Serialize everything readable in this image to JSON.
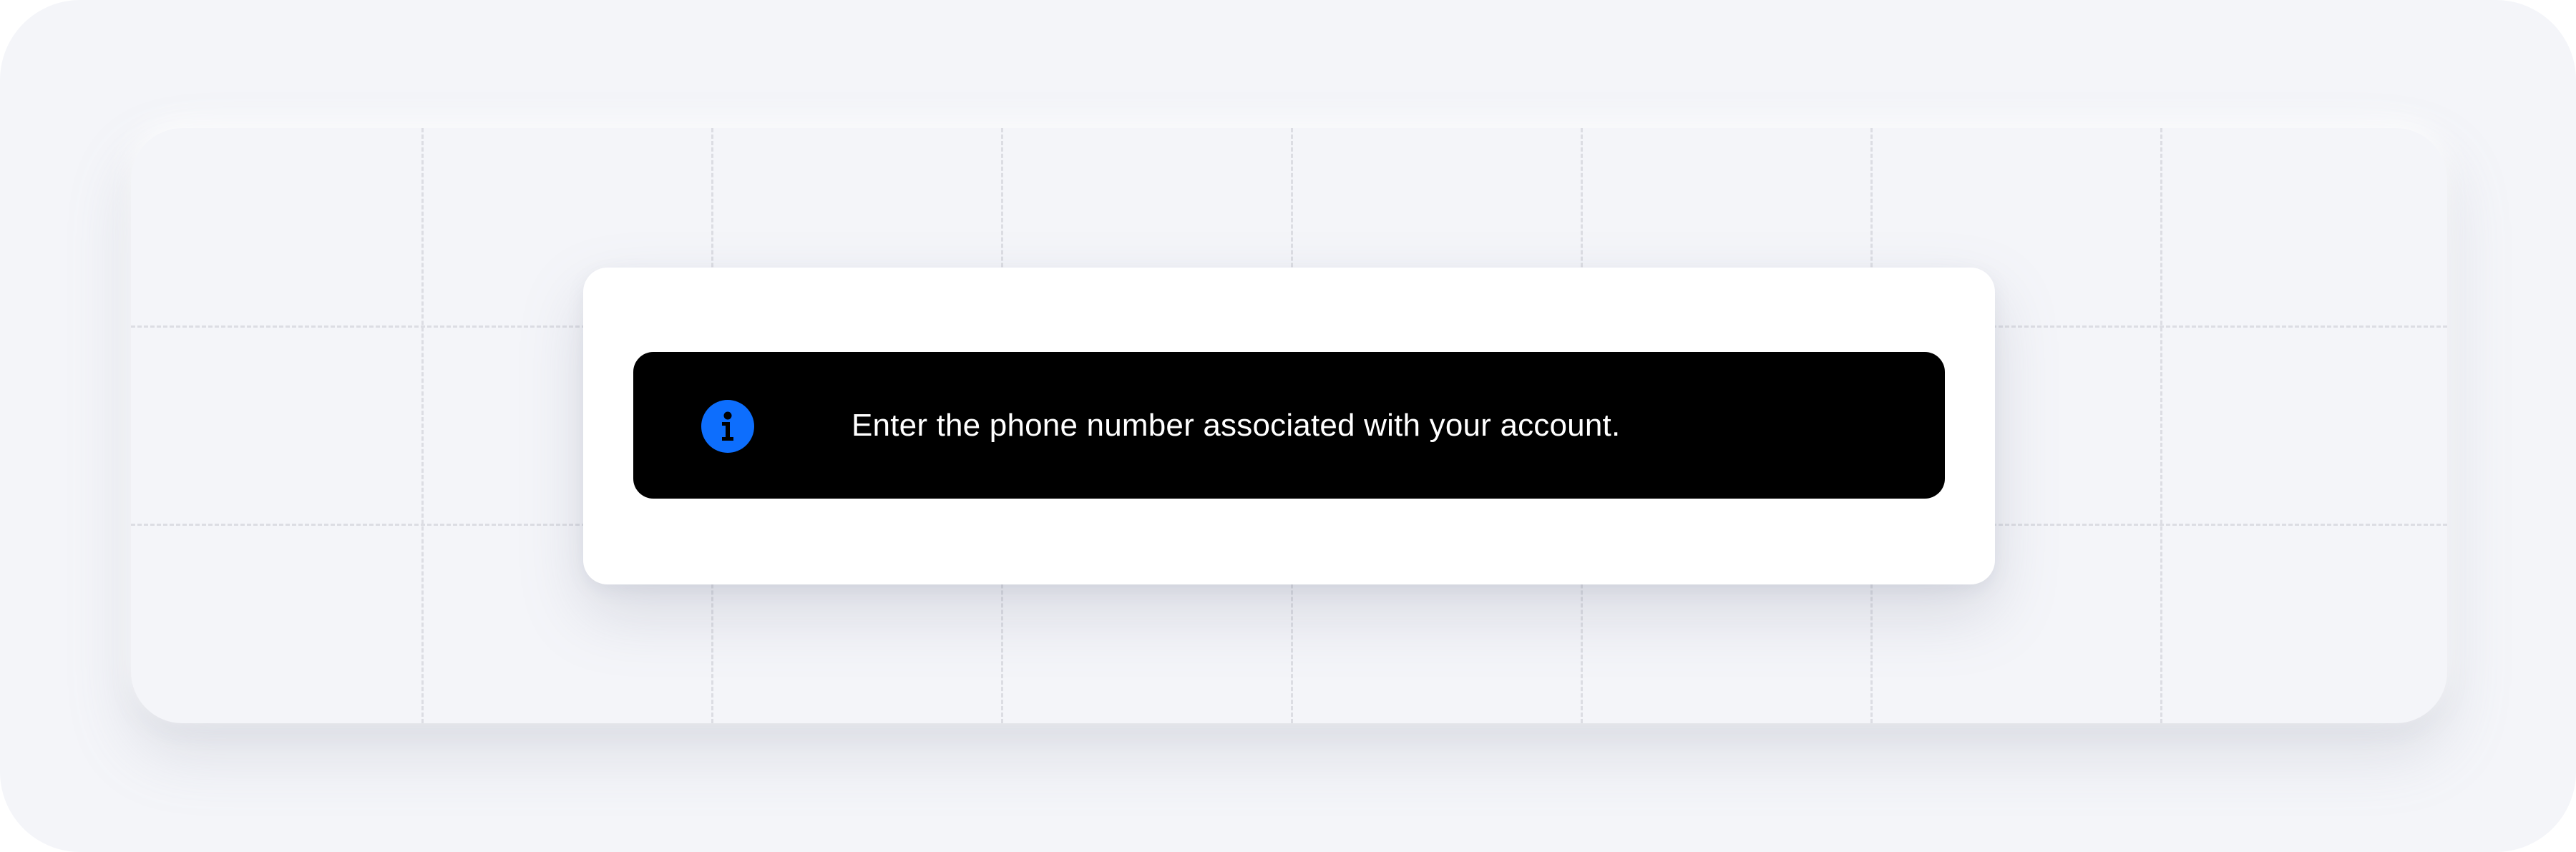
{
  "toast": {
    "message": "Enter the phone number associated with your account.",
    "icon": "info-icon",
    "variant": "info",
    "background_color": "#000000",
    "icon_color": "#0d6efd",
    "text_color": "#ffffff"
  },
  "colors": {
    "page_background": "#f4f5f9",
    "card_background": "#ffffff",
    "grid_line": "#dcdde3"
  }
}
